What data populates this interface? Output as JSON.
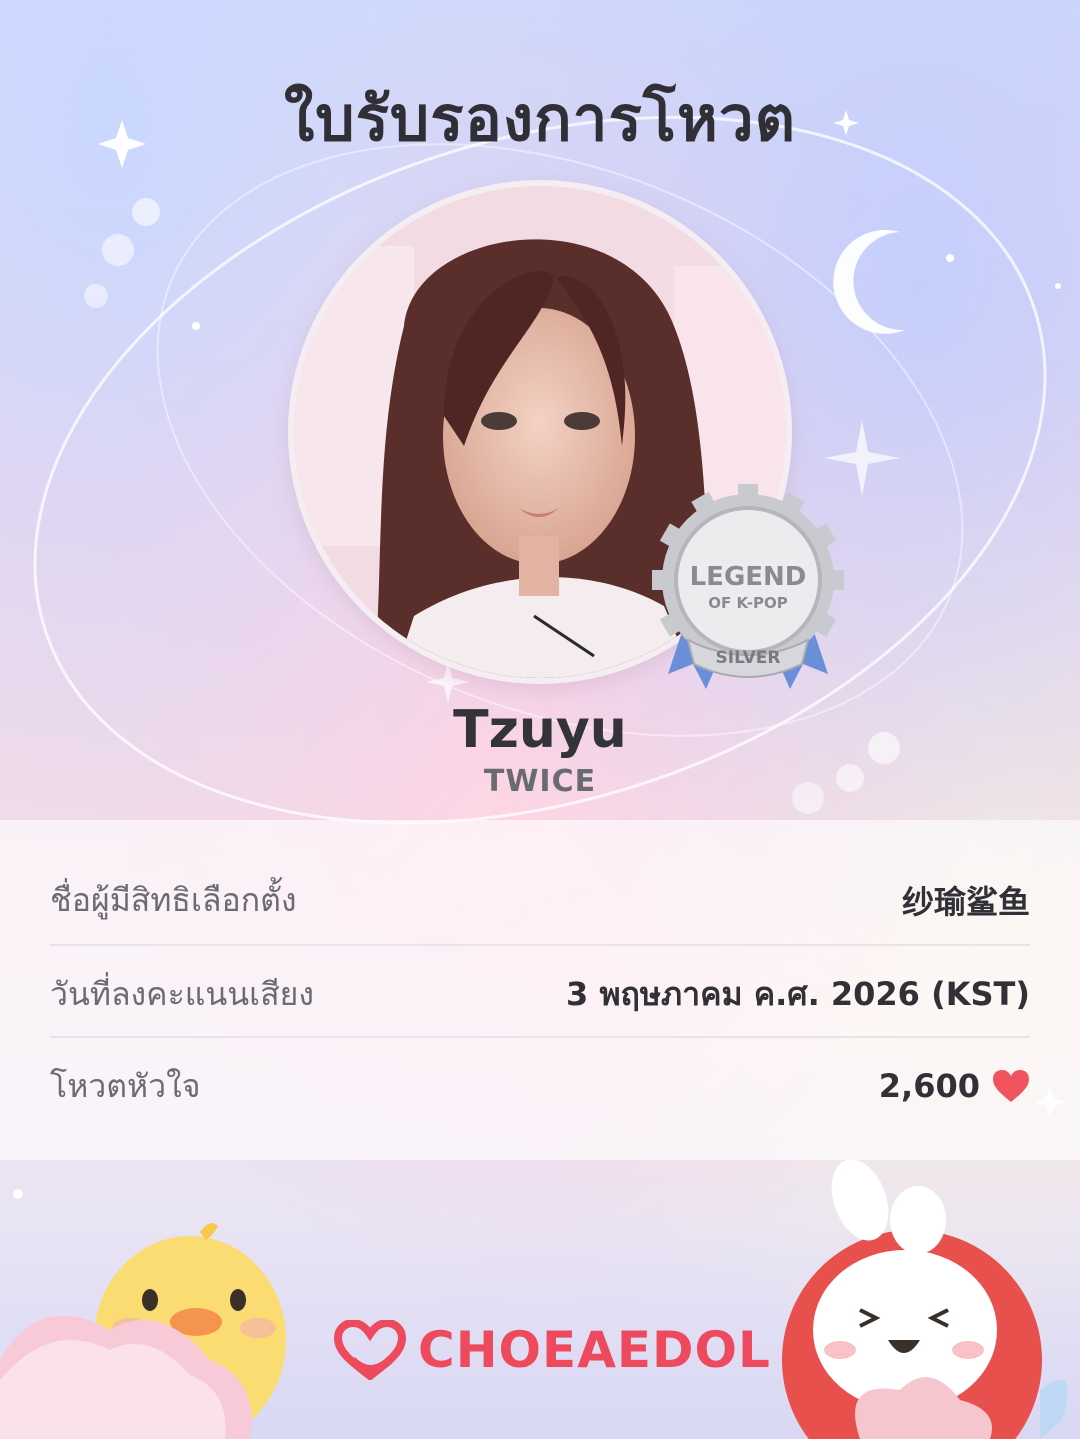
{
  "certificate": {
    "title": "ใบรับรองการโหวต"
  },
  "idol": {
    "name": "Tzuyu",
    "group": "TWICE"
  },
  "badge": {
    "line1": "LEGEND",
    "line2": "OF K-POP",
    "tier": "SILVER"
  },
  "details": [
    {
      "label": "ชื่อผู้มีสิทธิเลือกตั้ง",
      "value": "纱瑜鲨鱼"
    },
    {
      "label": "วันที่ลงคะแนนเสียง",
      "value": "3 พฤษภาคม ค.ศ. 2026 (KST)"
    },
    {
      "label": "โหวตหัวใจ",
      "value": "2,600"
    }
  ],
  "brand": {
    "name": "CHOEAEDOL",
    "color": "#ee4a5e"
  },
  "icons": {
    "heart": "heart-icon",
    "logo": "choeaedol-logo-icon"
  },
  "colors": {
    "heart": "#f0545f",
    "badge_silver": "#c9cacf",
    "ribbon": "#6a8fd8"
  }
}
